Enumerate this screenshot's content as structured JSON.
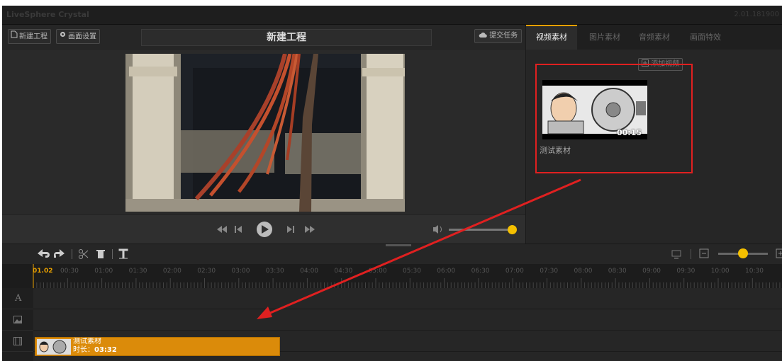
{
  "app": {
    "title": "LiveSphere Crystal",
    "version": "2.01.181900"
  },
  "toolbar": {
    "new_project_label": "新建工程",
    "screen_settings_label": "画面设置",
    "project_name": "新建工程",
    "submit_label": "提交任务"
  },
  "media_panel": {
    "tabs": [
      {
        "label": "视频素材",
        "active": true
      },
      {
        "label": "图片素材",
        "active": false
      },
      {
        "label": "音频素材",
        "active": false
      },
      {
        "label": "画面特效",
        "active": false
      }
    ],
    "add_label": "添加视频",
    "items": [
      {
        "name": "测试素材",
        "duration": "00:15"
      }
    ]
  },
  "player": {
    "volume": 1.0
  },
  "timeline": {
    "current_time": "01.02",
    "ruler_ticks": [
      "00:30",
      "01:00",
      "01:30",
      "02:00",
      "02:30",
      "03:00",
      "03:30",
      "04:00",
      "04:30",
      "05:00",
      "05:30",
      "06:00",
      "06:30",
      "07:00",
      "07:30",
      "08:00",
      "08:30",
      "09:00",
      "09:30",
      "10:00",
      "10:30"
    ],
    "zoom_level": 0.5,
    "tracks": [
      {
        "icon": "text-track-icon",
        "label": "A"
      },
      {
        "icon": "image-track-icon"
      },
      {
        "icon": "video-track-icon"
      }
    ],
    "clip": {
      "name": "测试素材",
      "duration_label": "时长：",
      "duration": "03:32"
    }
  },
  "colors": {
    "accent": "#e8a000",
    "annotation": "#e02020",
    "clip": "#db8b0a"
  }
}
